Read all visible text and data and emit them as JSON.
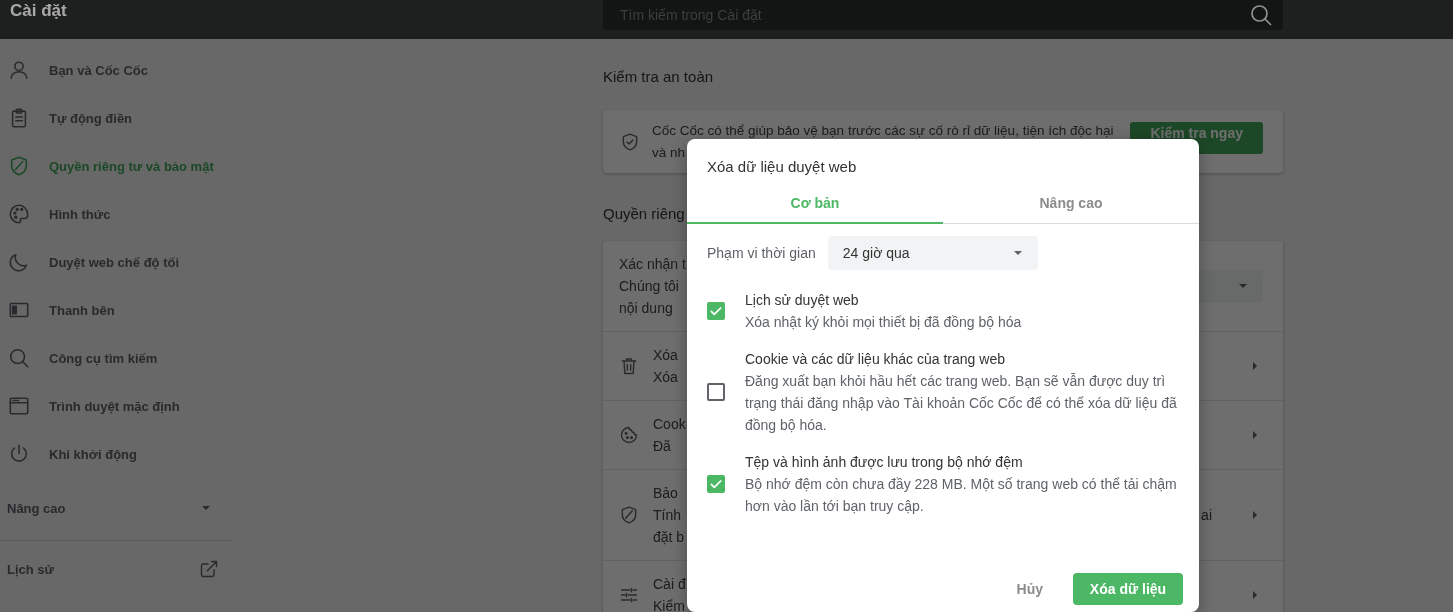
{
  "header": {
    "title": "Cài đặt",
    "search": {
      "placeholder": "Tìm kiếm trong Cài đặt"
    }
  },
  "sidebar": {
    "items": [
      {
        "label": "Bạn và Cốc Cốc",
        "kind": "person",
        "selected": false
      },
      {
        "label": "Tự động điền",
        "kind": "clipboard",
        "selected": false
      },
      {
        "label": "Quyền riêng tư và bảo mật",
        "kind": "shield",
        "selected": true
      },
      {
        "label": "Hình thức",
        "kind": "palette",
        "selected": false
      },
      {
        "label": "Duyệt web chế độ tối",
        "kind": "moon",
        "selected": false
      },
      {
        "label": "Thanh bên",
        "kind": "sidebar",
        "selected": false
      },
      {
        "label": "Công cụ tìm kiếm",
        "kind": "search",
        "selected": false
      },
      {
        "label": "Trình duyệt mặc định",
        "kind": "browser",
        "selected": false
      },
      {
        "label": "Khi khởi động",
        "kind": "power",
        "selected": false
      }
    ],
    "advanced": {
      "label": "Nâng cao",
      "expanded": false
    },
    "history": {
      "label": "Lịch sử"
    }
  },
  "safety_check": {
    "heading": "Kiểm tra an toàn",
    "text_lines": [
      "Cốc Cốc có thể giúp bảo vệ bạn trước các sự cố rò rỉ dữ liệu, tiện ích độc hại",
      "và nh"
    ],
    "button": "Kiểm tra ngay"
  },
  "privacy": {
    "heading": "Quyền riêng",
    "rows": [
      {
        "kind": "dropdown",
        "lines": [
          "Xác nhận t",
          "Chúng tôi",
          "nội dung"
        ]
      },
      {
        "kind": "trash",
        "lines": [
          "Xóa",
          "Xóa"
        ]
      },
      {
        "kind": "cookie",
        "lines": [
          "Cook",
          "Đã"
        ]
      },
      {
        "kind": "shield",
        "lines": [
          "Bảo",
          "Tính",
          "đặt b"
        ],
        "trailing": "ai"
      },
      {
        "kind": "sliders",
        "lines": [
          "Cài đ",
          "Kiểm"
        ]
      }
    ]
  },
  "dialog": {
    "title": "Xóa dữ liệu duyệt web",
    "tabs": [
      {
        "label": "Cơ bản",
        "selected": true
      },
      {
        "label": "Nâng cao",
        "selected": false
      }
    ],
    "time_range": {
      "label": "Phạm vi thời gian",
      "value": "24 giờ qua"
    },
    "options": [
      {
        "title": "Lịch sử duyệt web",
        "description": "Xóa nhật ký khỏi mọi thiết bị đã đồng bộ hóa",
        "checked": true
      },
      {
        "title": "Cookie và các dữ liệu khác của trang web",
        "description": "Đăng xuất bạn khỏi hầu hết các trang web. Bạn sẽ vẫn được duy trì trạng thái đăng nhập vào Tài khoản Cốc Cốc để có thể xóa dữ liệu đã đồng bộ hóa.",
        "checked": false
      },
      {
        "title": "Tệp và hình ảnh được lưu trong bộ nhớ đệm",
        "description": "Bộ nhớ đệm còn chưa đầy 228 MB. Một số trang web có thể tải chậm hơn vào lần tới bạn truy cập.",
        "checked": true
      }
    ],
    "buttons": {
      "cancel": "Hủy",
      "confirm": "Xóa dữ liệu"
    }
  }
}
